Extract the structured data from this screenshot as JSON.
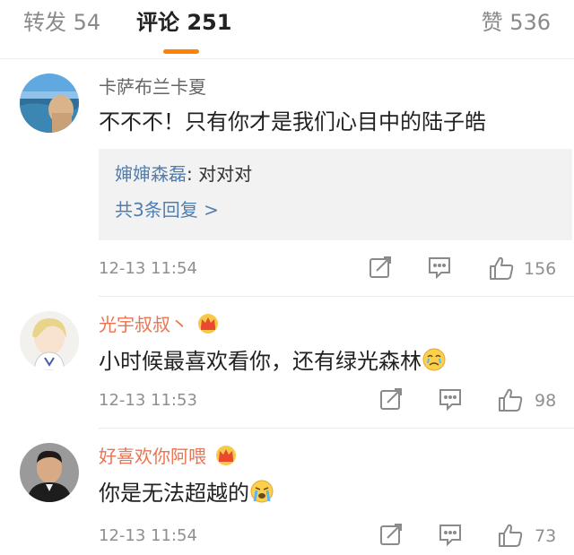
{
  "tabs": {
    "repost": "转发 54",
    "comments": "评论 251",
    "likes": "赞 536"
  },
  "accent_color": "#ff8200",
  "link_color": "#507daf",
  "comments": [
    {
      "username": "卡萨布兰卡夏",
      "content": "不不不！只有你才是我们心目中的陆子皓",
      "reply": {
        "name": "婶婶森磊",
        "separator": ": ",
        "text": "对对对",
        "more": "共3条回复 >"
      },
      "time": "12-13 11:54",
      "likes": "156"
    },
    {
      "username": "光宇叔叔丶",
      "badge": "crown-icon",
      "content": "小时候最喜欢看你，还有绿光森林",
      "emoji": "crying-face-icon",
      "time": "12-13 11:53",
      "likes": "98"
    },
    {
      "username": "好喜欢你阿喂",
      "badge": "crown-icon",
      "content": "你是无法超越的",
      "emoji": "loudly-crying-face-icon",
      "time": "12-13 11:54",
      "likes": "73"
    }
  ]
}
